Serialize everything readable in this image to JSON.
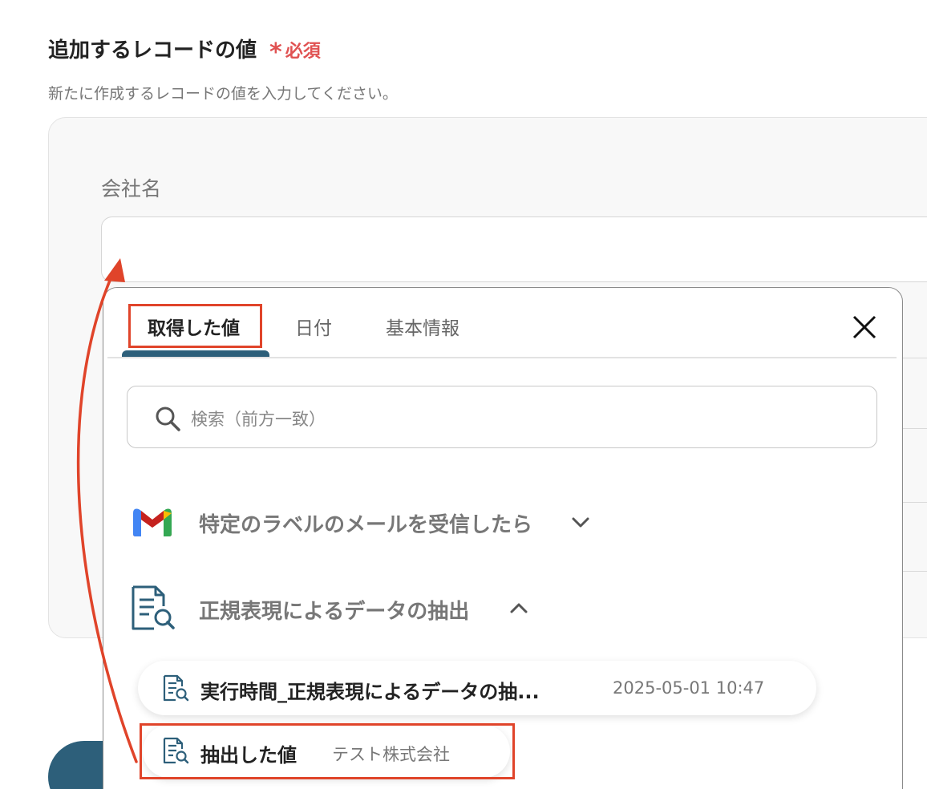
{
  "form": {
    "section_title": "追加するレコードの値",
    "required_mark": "*",
    "required_label": "必須",
    "description": "新たに作成するレコードの値を入力してください。",
    "field_label": "会社名",
    "field_value": ""
  },
  "popup": {
    "tabs": [
      {
        "label": "取得した値",
        "active": true
      },
      {
        "label": "日付",
        "active": false
      },
      {
        "label": "基本情報",
        "active": false
      }
    ],
    "search_placeholder": "検索（前方一致）",
    "groups": [
      {
        "label": "特定のラベルのメールを受信したら",
        "icon": "gmail-icon",
        "expanded": false
      },
      {
        "label": "正規表現によるデータの抽出",
        "icon": "document-search-icon",
        "expanded": true
      }
    ],
    "items": [
      {
        "name": "実行時間_正規表現によるデータの抽...",
        "value": "2025-05-01 10:47",
        "icon": "document-search-icon"
      },
      {
        "name": "抽出した値",
        "value": "テスト株式会社",
        "icon": "document-search-icon",
        "highlighted": true
      }
    ]
  },
  "colors": {
    "accent": "#2d5f7a",
    "required": "#e05252",
    "highlight": "#e0442a"
  }
}
